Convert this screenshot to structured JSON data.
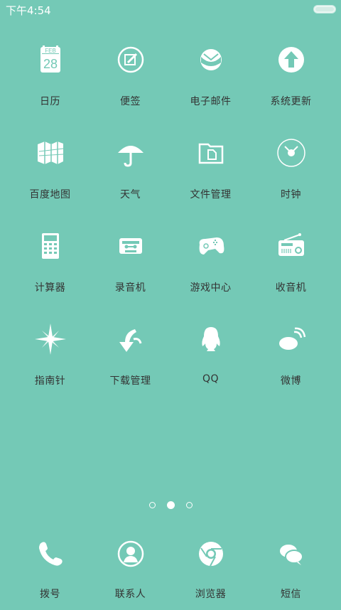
{
  "status": {
    "time": "下午4:54"
  },
  "calendar_icon": {
    "month": "FEB",
    "day": "28"
  },
  "apps": [
    {
      "label": "日历",
      "icon": "calendar-icon"
    },
    {
      "label": "便签",
      "icon": "notes-icon"
    },
    {
      "label": "电子邮件",
      "icon": "email-icon"
    },
    {
      "label": "系统更新",
      "icon": "update-icon"
    },
    {
      "label": "百度地图",
      "icon": "map-icon"
    },
    {
      "label": "天气",
      "icon": "weather-icon"
    },
    {
      "label": "文件管理",
      "icon": "folder-icon"
    },
    {
      "label": "时钟",
      "icon": "clock-icon"
    },
    {
      "label": "计算器",
      "icon": "calculator-icon"
    },
    {
      "label": "录音机",
      "icon": "recorder-icon"
    },
    {
      "label": "游戏中心",
      "icon": "gamepad-icon"
    },
    {
      "label": "收音机",
      "icon": "radio-icon"
    },
    {
      "label": "指南针",
      "icon": "compass-icon"
    },
    {
      "label": "下载管理",
      "icon": "download-icon"
    },
    {
      "label": "QQ",
      "icon": "qq-icon"
    },
    {
      "label": "微博",
      "icon": "weibo-icon"
    }
  ],
  "page_indicator": {
    "pages": 3,
    "current": 2
  },
  "dock": [
    {
      "label": "拨号",
      "icon": "phone-icon"
    },
    {
      "label": "联系人",
      "icon": "contacts-icon"
    },
    {
      "label": "浏览器",
      "icon": "browser-icon"
    },
    {
      "label": "短信",
      "icon": "messages-icon"
    }
  ]
}
